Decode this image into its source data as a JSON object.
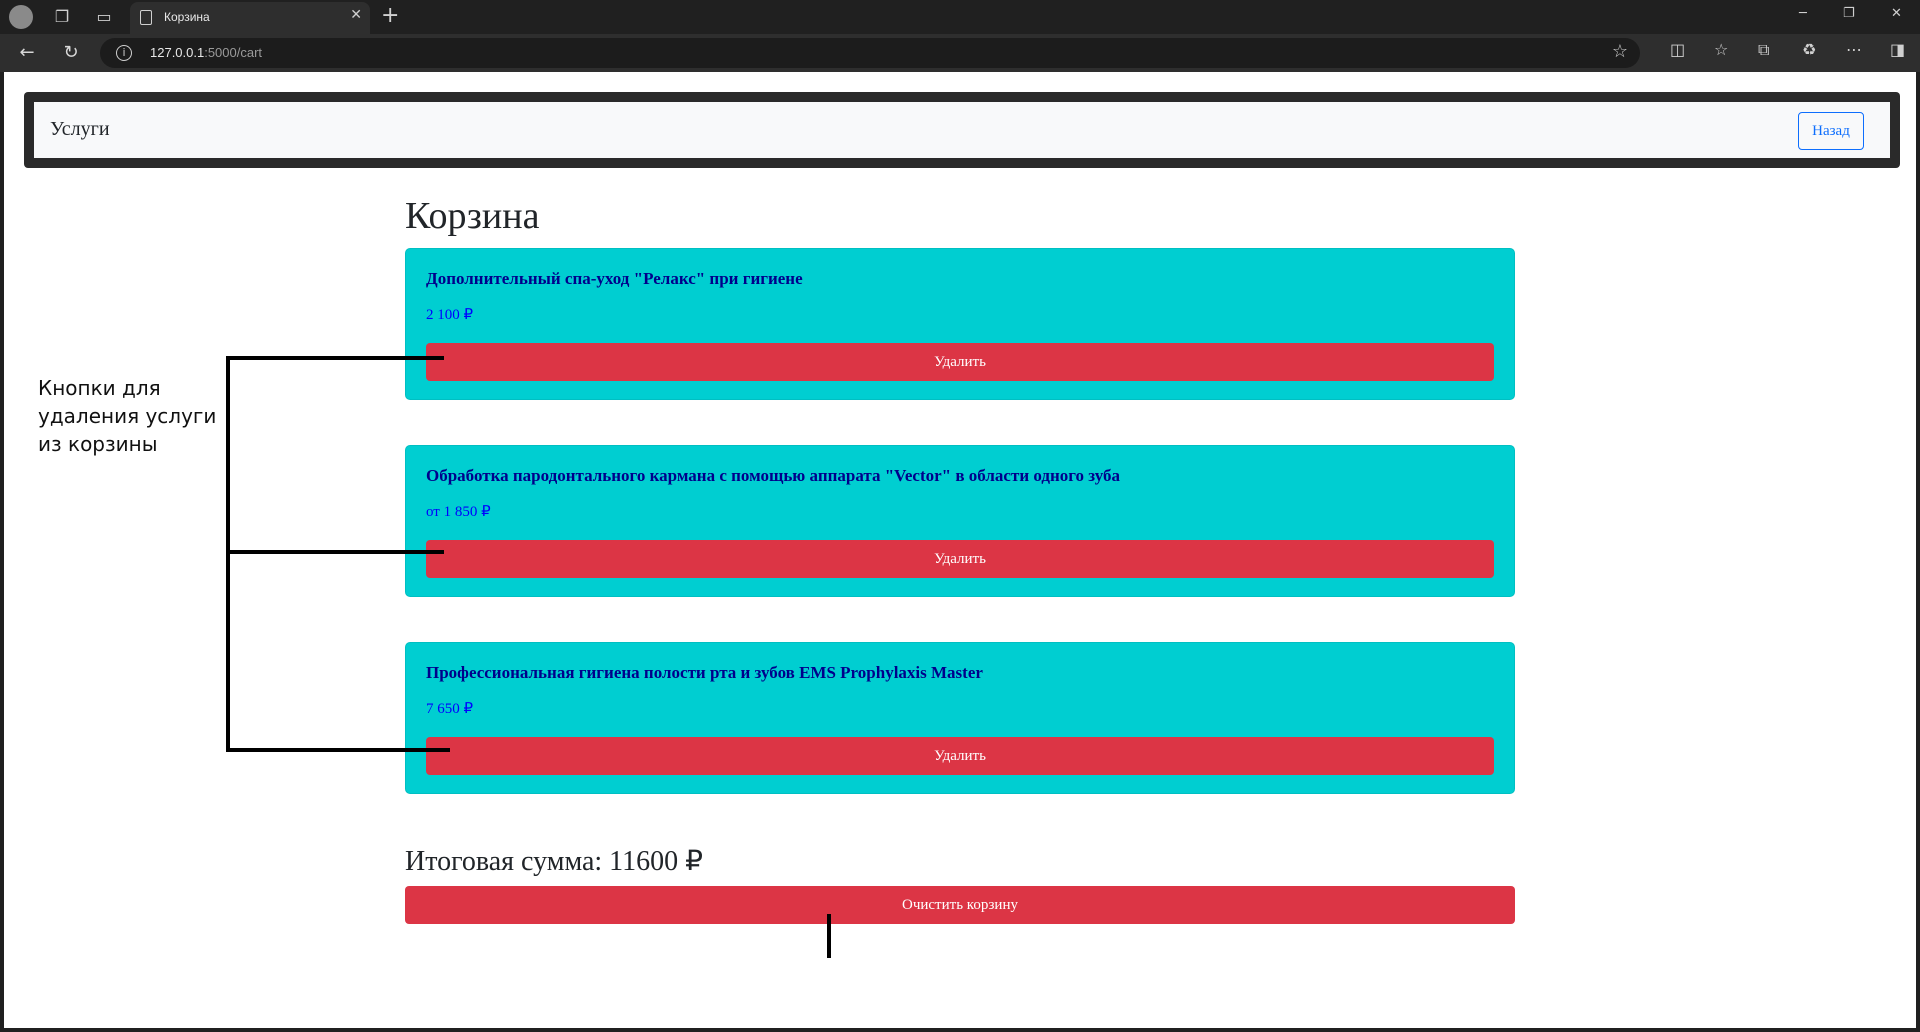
{
  "browser": {
    "tab_title": "Корзина",
    "url_host": "127.0.0.1",
    "url_rest": ":5000/cart"
  },
  "navbar": {
    "brand": "Услуги",
    "back_label": "Назад"
  },
  "page": {
    "title": "Корзина"
  },
  "cart_items": [
    {
      "title": "Дополнительный спа-уход \"Релакс\" при гигиене",
      "price": "2 100 ₽",
      "delete_label": "Удалить"
    },
    {
      "title": "Обработка пародонтального кармана с помощью аппарата \"Vector\" в области одного зуба",
      "price": "от 1 850 ₽",
      "delete_label": "Удалить"
    },
    {
      "title": "Профессиональная гигиена полости рта и зубов EMS Prophylaxis Master",
      "price": "7 650 ₽",
      "delete_label": "Удалить"
    }
  ],
  "summary": {
    "total": "Итоговая сумма: 11600 ₽",
    "clear_label": "Очистить корзину"
  },
  "annotation": {
    "text": "Кнопки для удаления услуги из корзины"
  },
  "colors": {
    "card_bg": "#00ced1",
    "danger": "#dc3545",
    "title_text": "#00008b",
    "price_text": "#0000ff",
    "link_primary": "#0d6efd"
  }
}
